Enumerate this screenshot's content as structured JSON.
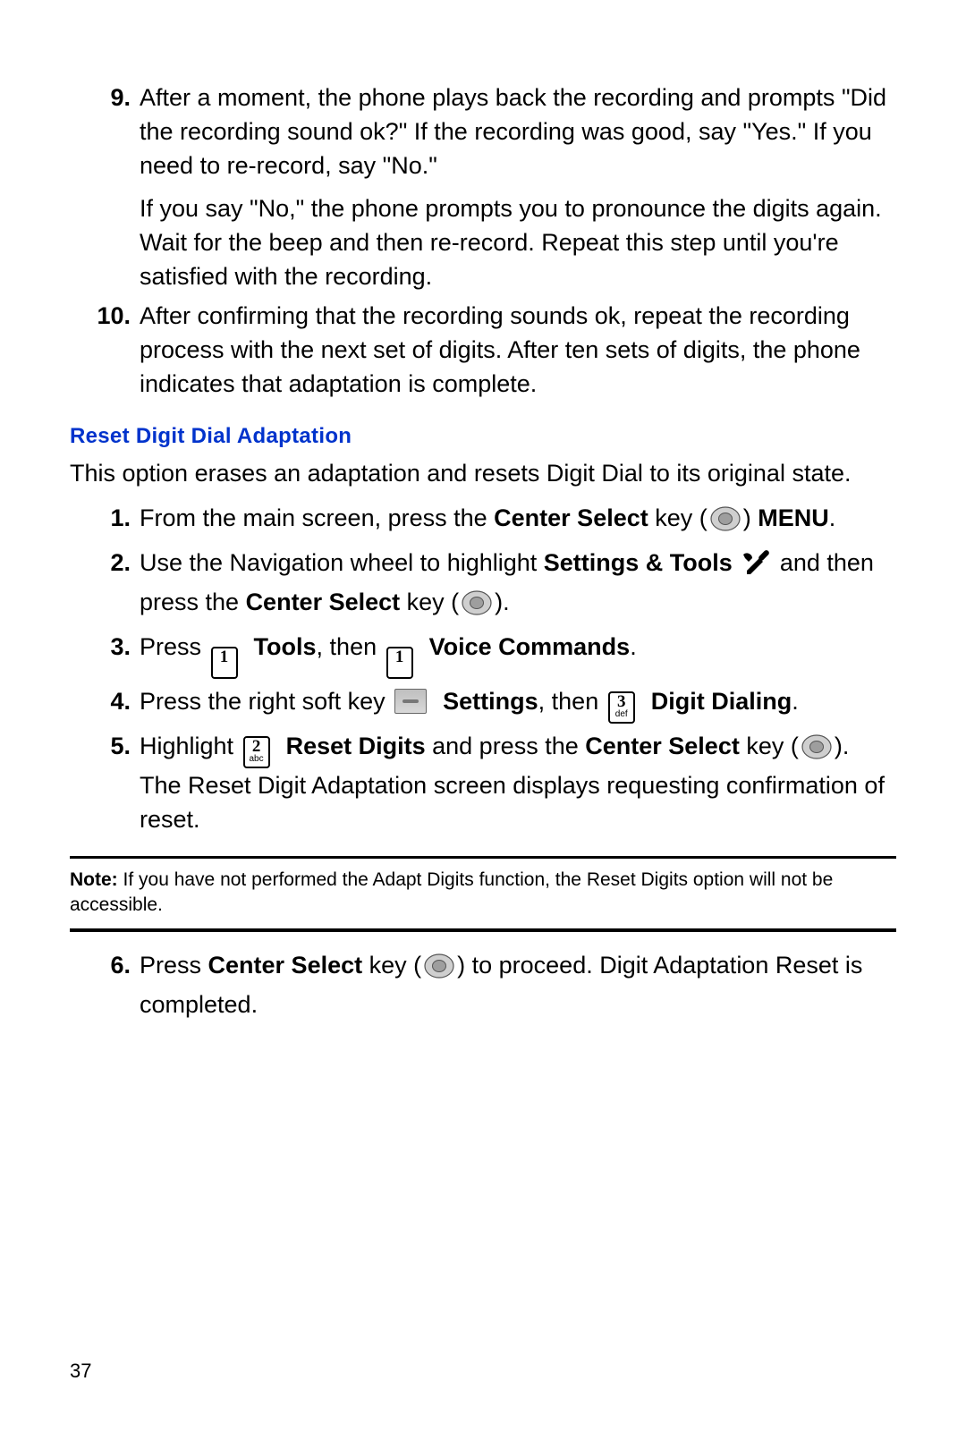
{
  "top_list": [
    {
      "num": "9.",
      "para1": "After a moment, the phone plays back the recording and prompts \"Did the recording sound ok?\" If the recording was good, say \"Yes.\" If you need to re-record, say \"No.\"",
      "para2": "If you say \"No,\" the phone prompts you to pronounce the digits again. Wait for the beep and then re-record. Repeat this step until you're satisfied with the recording."
    },
    {
      "num": "10.",
      "para1": "After confirming that the recording sounds ok, repeat the recording process with the next set of digits. After ten sets of digits, the phone indicates that adaptation is complete."
    }
  ],
  "section_heading": "Reset Digit Dial Adaptation",
  "intro": "This option erases an adaptation and resets Digit Dial to its original state.",
  "steps": {
    "s1": {
      "num": "1.",
      "t1": "From the main screen, press the ",
      "b1": "Center Select",
      "t2": " key (",
      "t3": ") ",
      "b2": "MENU",
      "t4": "."
    },
    "s2": {
      "num": "2.",
      "t1": "Use the Navigation wheel to highlight ",
      "b1": "Settings & Tools",
      "t2": " and then press the ",
      "b2": "Center Select",
      "t3": " key (",
      "t4": ")."
    },
    "s3": {
      "num": "3.",
      "t1": "Press ",
      "b1": "Tools",
      "t2": ", then ",
      "b2": "Voice Commands",
      "t3": "."
    },
    "s4": {
      "num": "4.",
      "t1": "Press the right soft key ",
      "b1": "Settings",
      "t2": ", then ",
      "b2": "Digit Dialing",
      "t3": "."
    },
    "s5": {
      "num": "5.",
      "t1": "Highlight ",
      "b1": "Reset Digits",
      "t2": " and press the ",
      "b2": "Center Select",
      "t3": " key (",
      "t4": "). The Reset Digit Adaptation screen displays requesting confirmation of reset."
    },
    "s6": {
      "num": "6.",
      "t1": "Press ",
      "b1": "Center Select",
      "t2": " key (",
      "t3": ") to proceed. Digit Adaptation Reset is completed."
    }
  },
  "keys": {
    "k1": {
      "d": "1",
      "s": ""
    },
    "k2": {
      "d": "2",
      "s": "abc"
    },
    "k3": {
      "d": "3",
      "s": "def"
    }
  },
  "note": {
    "label": "Note:",
    "text": " If you have not performed the Adapt Digits function, the Reset Digits option will not be accessible."
  },
  "page_number": "37"
}
